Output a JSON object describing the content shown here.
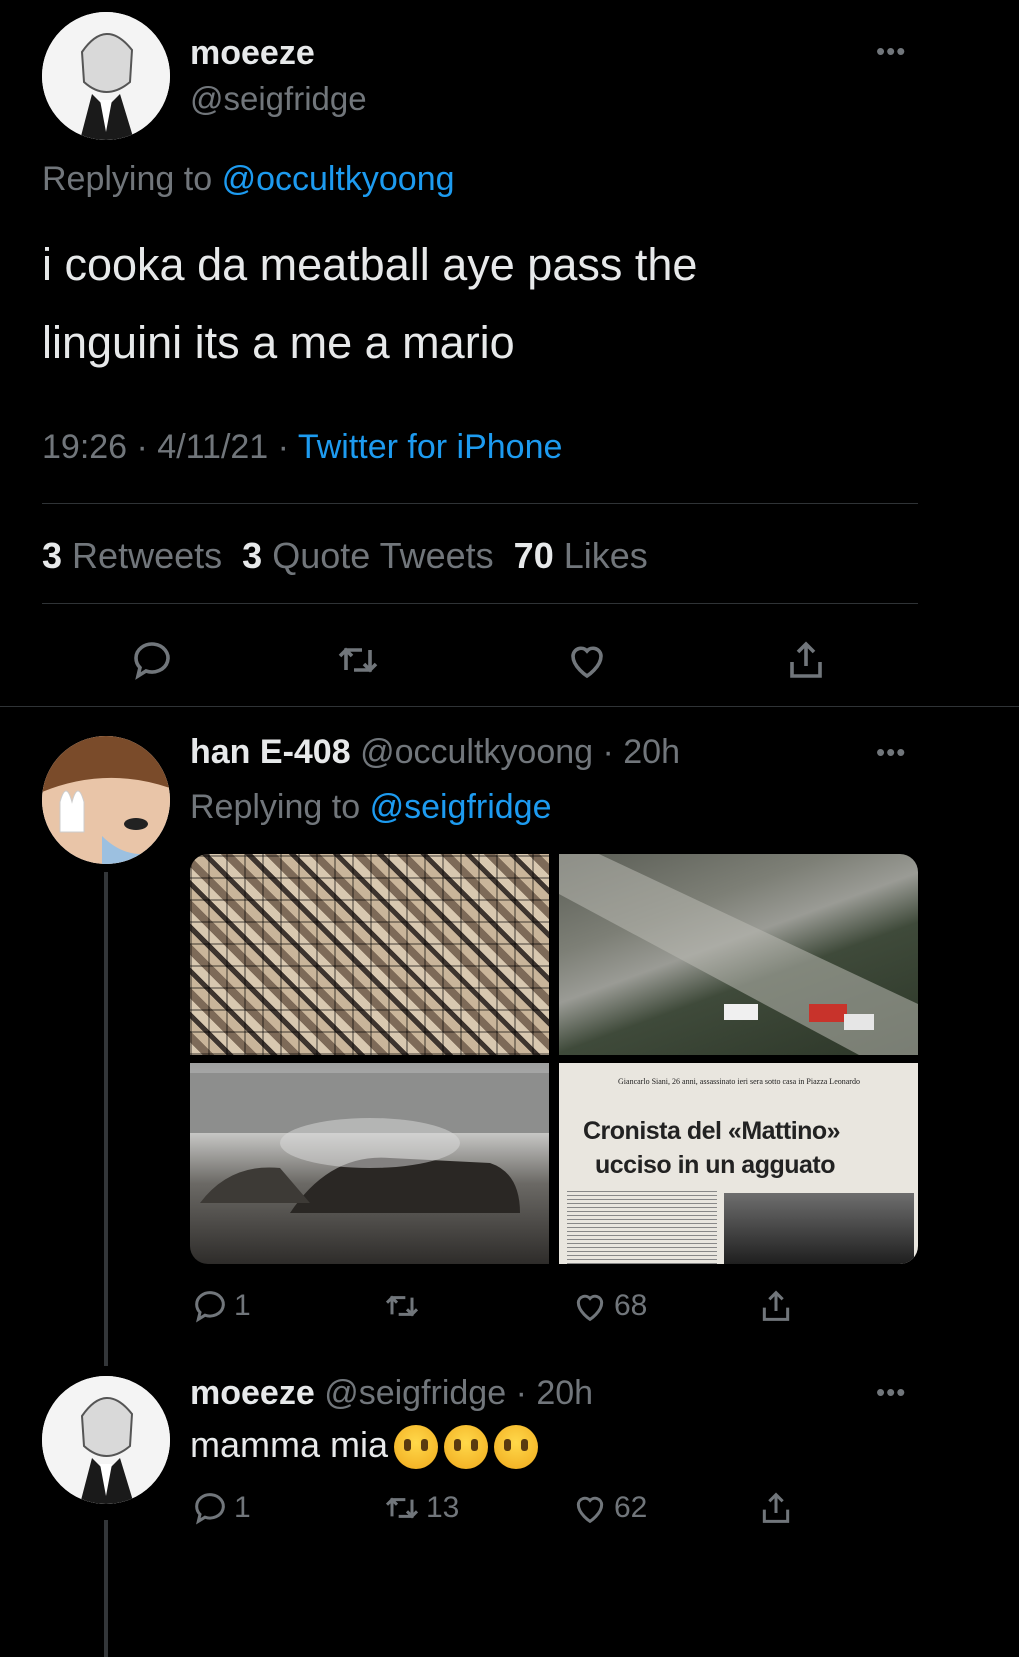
{
  "main_tweet": {
    "display_name": "moeeze",
    "handle": "@seigfridge",
    "replying_prefix": "Replying to",
    "replying_to": "@occultkyoong",
    "text_line1": "i cooka da meatball aye pass the",
    "text_line2": "linguini its a me a mario",
    "time": "19:26 · 4/11/21 ·",
    "source": "Twitter for iPhone",
    "retweets_count": "3",
    "retweets_label": "Retweets",
    "quotes_count": "3",
    "quotes_label": "Quote Tweets",
    "likes_count": "70",
    "likes_label": "Likes"
  },
  "reply1": {
    "display_name": "han E-408",
    "handle_time": "@occultkyoong · 20h",
    "replying_prefix": "Replying to",
    "replying_to": "@seigfridge",
    "newspaper_line": "Giancarlo Siani, 26 anni, assassinato ieri sera sotto casa in Piazza Leonardo",
    "headline1": "Cronista del «Mattino»",
    "headline2": "ucciso in un agguato",
    "reply_count": "1",
    "retweet_count": "",
    "like_count": "68"
  },
  "reply2": {
    "display_name": "moeeze",
    "handle_time": "@seigfridge · 20h",
    "text": "mamma mia",
    "emoji": "crying-face-icon",
    "reply_count": "1",
    "retweet_count": "13",
    "like_count": "62"
  },
  "colors": {
    "background": "#000000",
    "accent": "#1d9bf0",
    "muted": "#71767b",
    "divider": "#2f3336"
  }
}
